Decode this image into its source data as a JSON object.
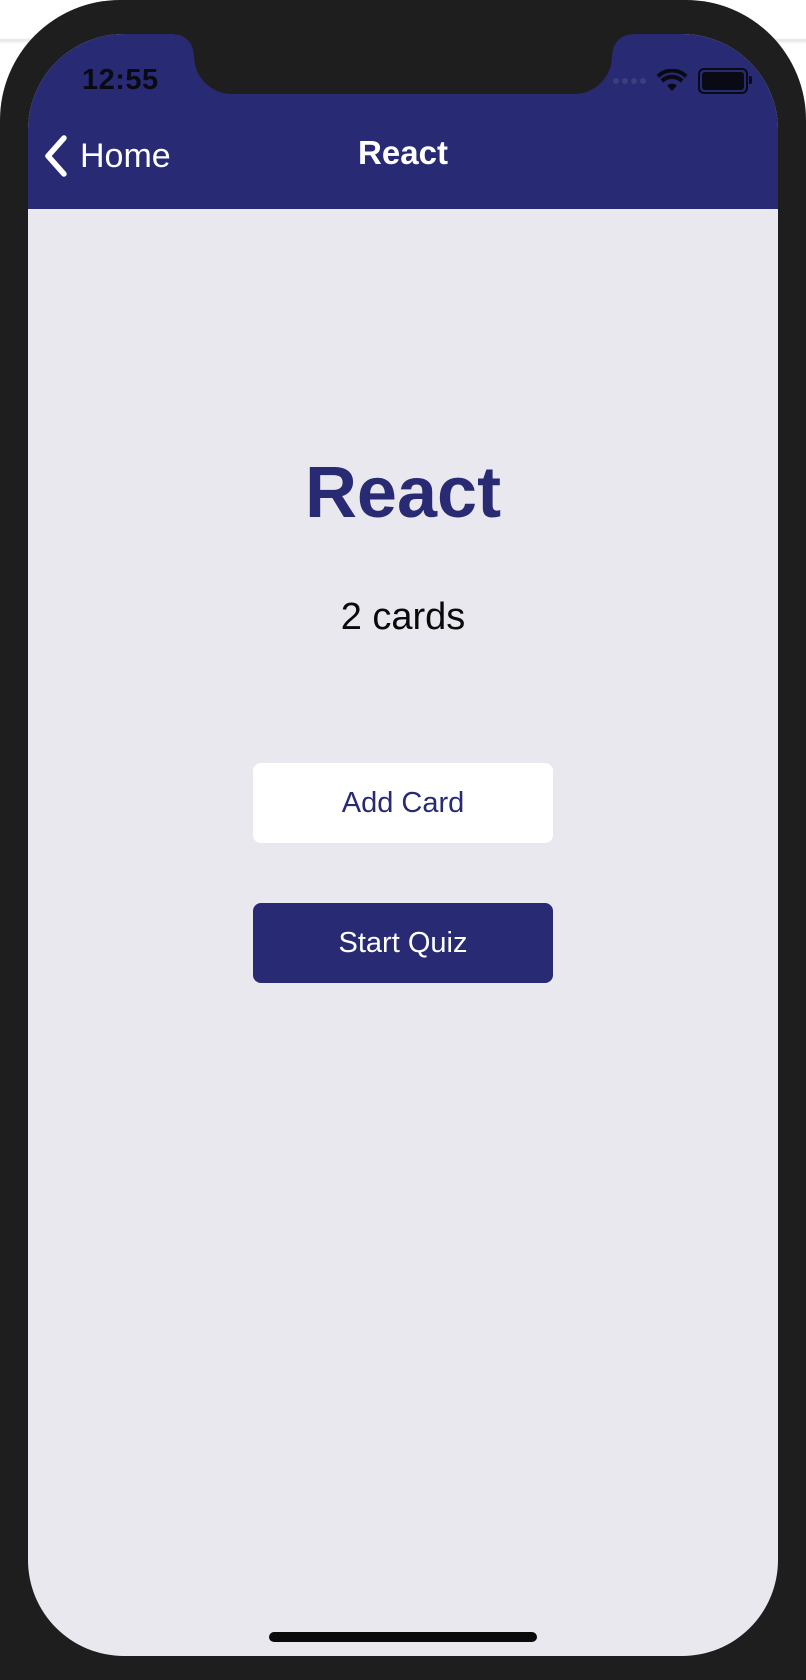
{
  "status_bar": {
    "time": "12:55"
  },
  "nav": {
    "back_label": "Home",
    "title": "React"
  },
  "deck": {
    "title": "React",
    "card_count": "2 cards"
  },
  "actions": {
    "add_card_label": "Add Card",
    "start_quiz_label": "Start Quiz"
  },
  "colors": {
    "primary": "#282a73",
    "background": "#e9e8ef",
    "surface": "#ffffff"
  },
  "icons": {
    "back": "chevron-left-icon",
    "wifi": "wifi-icon",
    "battery": "battery-icon",
    "signal": "cellular-signal-icon"
  }
}
